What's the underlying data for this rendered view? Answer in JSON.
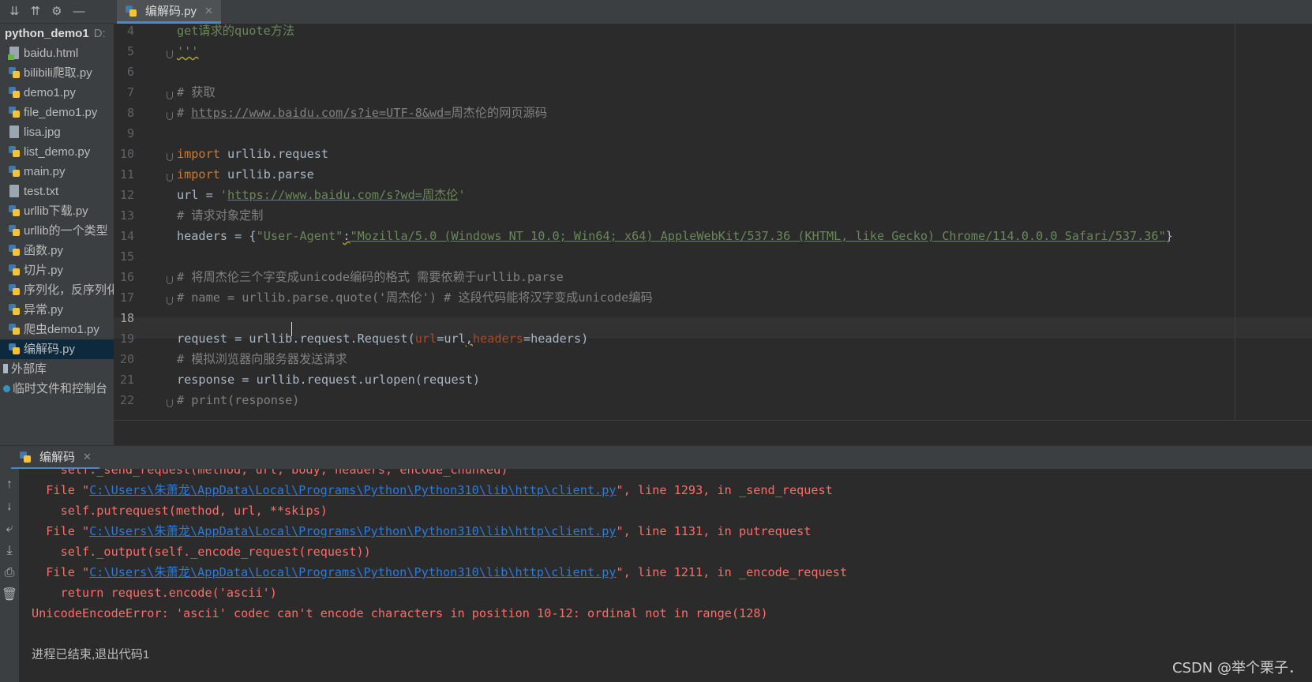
{
  "project": {
    "root_name": "python_demo1",
    "root_path": "D:",
    "files": [
      {
        "name": "baidu.html",
        "type": "html"
      },
      {
        "name": "bilibili爬取.py",
        "type": "py"
      },
      {
        "name": "demo1.py",
        "type": "py"
      },
      {
        "name": "file_demo1.py",
        "type": "py"
      },
      {
        "name": "lisa.jpg",
        "type": "img"
      },
      {
        "name": "list_demo.py",
        "type": "py"
      },
      {
        "name": "main.py",
        "type": "py"
      },
      {
        "name": "test.txt",
        "type": "txt"
      },
      {
        "name": "urllib下载.py",
        "type": "py"
      },
      {
        "name": "urllib的一个类型",
        "type": "py"
      },
      {
        "name": "函数.py",
        "type": "py"
      },
      {
        "name": "切片.py",
        "type": "py"
      },
      {
        "name": "序列化，反序列化",
        "type": "py"
      },
      {
        "name": "异常.py",
        "type": "py"
      },
      {
        "name": "爬虫demo1.py",
        "type": "py"
      },
      {
        "name": "编解码.py",
        "type": "py",
        "selected": true
      }
    ],
    "external_libs": "外部库",
    "scratches": "临时文件和控制台"
  },
  "editor": {
    "tab_label": "编解码.py",
    "current_line": 18,
    "lines": [
      {
        "no": "4",
        "text": "get请求的quote方法"
      },
      {
        "no": "5",
        "text": "'''"
      },
      {
        "no": "6",
        "text": ""
      },
      {
        "no": "7",
        "text": "# 获取"
      },
      {
        "no": "8",
        "text": "# https://www.baidu.com/s?ie=UTF-8&wd=周杰伦的网页源码"
      },
      {
        "no": "9",
        "text": ""
      },
      {
        "no": "10",
        "text": "import urllib.request"
      },
      {
        "no": "11",
        "text": "import urllib.parse"
      },
      {
        "no": "12",
        "text": "url = 'https://www.baidu.com/s?wd=周杰伦'"
      },
      {
        "no": "13",
        "text": "# 请求对象定制"
      },
      {
        "no": "14",
        "text": "headers = {\"User-Agent\":\"Mozilla/5.0 (Windows NT 10.0; Win64; x64) AppleWebKit/537.36 (KHTML, like Gecko) Chrome/114.0.0.0 Safari/537.36\"}"
      },
      {
        "no": "15",
        "text": ""
      },
      {
        "no": "16",
        "text": "# 将周杰伦三个字变成unicode编码的格式 需要依赖于urllib.parse"
      },
      {
        "no": "17",
        "text": "# name = urllib.parse.quote('周杰伦') # 这段代码能将汉字变成unicode编码"
      },
      {
        "no": "18",
        "text": ""
      },
      {
        "no": "19",
        "text": "request = urllib.request.Request(url=url,headers=headers)"
      },
      {
        "no": "20",
        "text": "# 模拟浏览器向服务器发送请求"
      },
      {
        "no": "21",
        "text": "response = urllib.request.urlopen(request)"
      },
      {
        "no": "22",
        "text": "# print(response)"
      }
    ]
  },
  "run": {
    "tab_label": "编解码",
    "console": [
      {
        "kind": "err",
        "text": "    self._send_request(method, url, body, headers, encode_chunked)"
      },
      {
        "kind": "file",
        "pre": "  File \"",
        "link": "C:\\Users\\朱萧龙\\AppData\\Local\\Programs\\Python\\Python310\\lib\\http\\client.py",
        "post": "\", line 1293, in _send_request"
      },
      {
        "kind": "err",
        "text": "    self.putrequest(method, url, **skips)"
      },
      {
        "kind": "file",
        "pre": "  File \"",
        "link": "C:\\Users\\朱萧龙\\AppData\\Local\\Programs\\Python\\Python310\\lib\\http\\client.py",
        "post": "\", line 1131, in putrequest"
      },
      {
        "kind": "err",
        "text": "    self._output(self._encode_request(request))"
      },
      {
        "kind": "file",
        "pre": "  File \"",
        "link": "C:\\Users\\朱萧龙\\AppData\\Local\\Programs\\Python\\Python310\\lib\\http\\client.py",
        "post": "\", line 1211, in _encode_request"
      },
      {
        "kind": "err",
        "text": "    return request.encode('ascii')"
      },
      {
        "kind": "err",
        "text": "UnicodeEncodeError: 'ascii' codec can't encode characters in position 10-12: ordinal not in range(128)"
      },
      {
        "kind": "blank",
        "text": ""
      },
      {
        "kind": "plain",
        "text": "进程已结束,退出代码1"
      }
    ]
  },
  "watermark": "CSDN @举个栗子．",
  "colors": {
    "keyword": "#cc7832",
    "comment": "#808080",
    "string": "#6a8759",
    "error": "#ff6b68",
    "link": "#287bde",
    "selection": "#0d293e"
  },
  "icons": {
    "toolbar": [
      "expand-all-icon",
      "collapse-all-icon",
      "gear-icon",
      "minimize-icon"
    ],
    "run_toolbar": [
      "arrow-up-icon",
      "arrow-down-icon",
      "soft-wrap-icon",
      "scroll-to-end-icon",
      "print-icon",
      "trash-icon"
    ]
  }
}
